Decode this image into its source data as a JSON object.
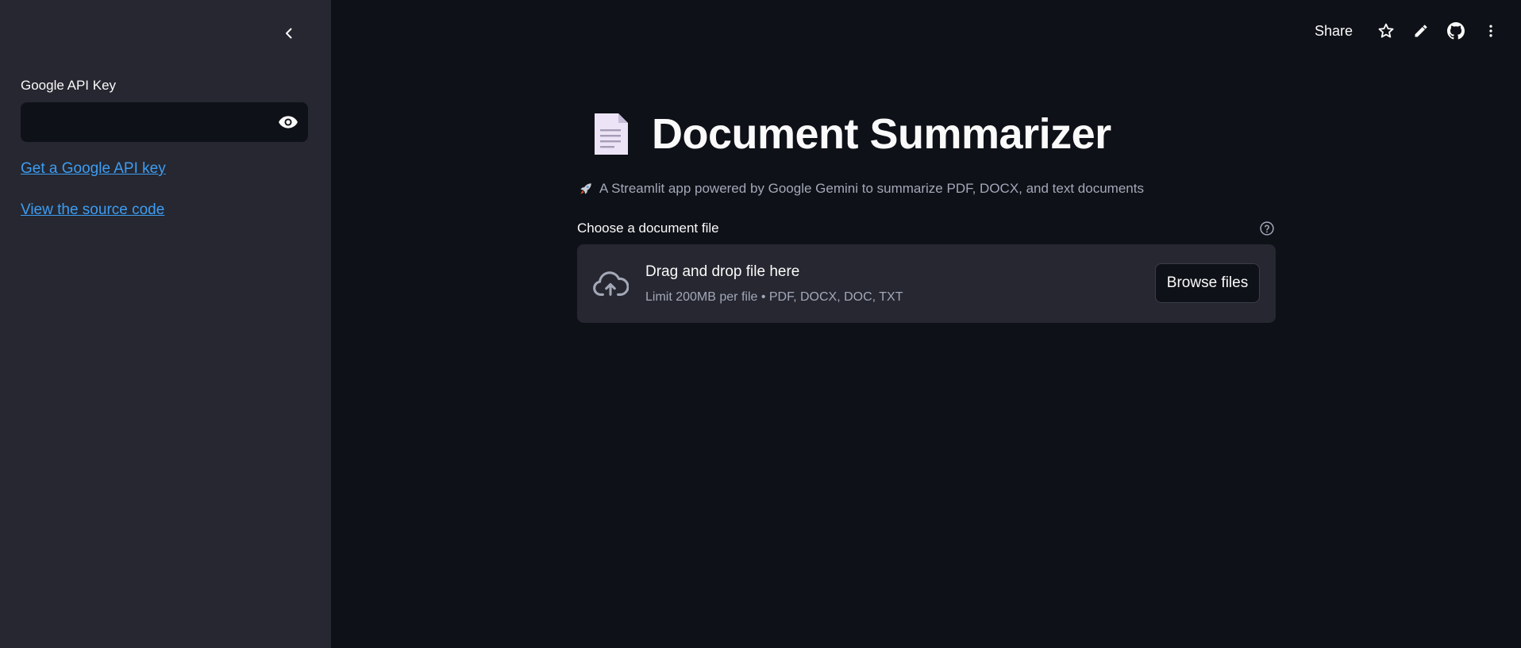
{
  "sidebar": {
    "api_key_label": "Google API Key",
    "api_key_value": "",
    "links": [
      "Get a Google API key",
      "View the source code"
    ]
  },
  "toolbar": {
    "share_label": "Share",
    "icons": [
      "star-icon",
      "edit-icon",
      "github-icon",
      "more-menu-icon"
    ]
  },
  "main": {
    "title": "Document Summarizer",
    "subtitle": "A Streamlit app powered by Google Gemini to summarize PDF, DOCX, and text documents",
    "uploader": {
      "label": "Choose a document file",
      "drop_title": "Drag and drop file here",
      "drop_sub": "Limit 200MB per file • PDF, DOCX, DOC, TXT",
      "browse_label": "Browse files"
    }
  },
  "colors": {
    "app_bg": "#0e1117",
    "sidebar_bg": "#262730",
    "link": "#3d9df3",
    "muted_text": "#a3a8b8"
  }
}
